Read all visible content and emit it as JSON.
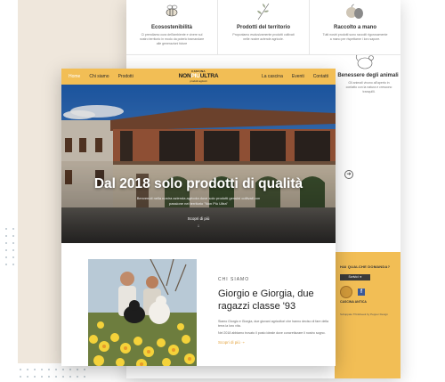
{
  "back_page": {
    "features": [
      {
        "title": "Ecosostenibilità",
        "desc": "Ci prendiamo cura dell'ambiente e vivere sul nostro territorio in modo da poterlo tramandare alle generazioni future",
        "icon": "bee-icon"
      },
      {
        "title": "Prodotti del territorio",
        "desc": "Proponiamo esclusivamente prodotti coltivati nelle nostre aziende agricole.",
        "icon": "herb-icon"
      },
      {
        "title": "Raccolto a mano",
        "desc": "Tutti nostri prodotti sono raccolti rigorosamente a mano per rispettarne i loro sapore.",
        "icon": "produce-icon"
      }
    ],
    "feature2": {
      "title": "Benessere degli animali",
      "desc": "Gli animali vivono all'aperto in contatto con la natura e crescono tranquilli.",
      "icon": "hen-icon"
    },
    "arrow": "➔",
    "cta": {
      "question": "HAI QUALCHE DOMANDA?",
      "button": "Scrivici ➔",
      "badge_text": "CASCINA ANTICA",
      "facebook": "f",
      "credit": "Sviluppato ThinkGeek by Pepper Design"
    }
  },
  "nav": {
    "left": [
      {
        "label": "Home",
        "active": true
      },
      {
        "label": "Chi siamo",
        "active": false
      },
      {
        "label": "Prodotti",
        "active": false
      }
    ],
    "right": [
      {
        "label": "La cascina"
      },
      {
        "label": "Eventi"
      },
      {
        "label": "Contatti"
      }
    ],
    "logo": {
      "line1": "CASCINA",
      "word1": "NON",
      "word2": "PIÙ",
      "word3": "ULTRA",
      "line3": "prodotti agricoli"
    }
  },
  "hero": {
    "title": "Dal 2018 solo prodotti di qualità",
    "subtitle": "Benvenuti nella nostra azienda agricola dove solo prodotti genuini coltivati con passione nel territorio \"Non Più Ultra\"",
    "more": "Scopri di più",
    "arrow": "↓"
  },
  "about": {
    "eyebrow": "CHI SIAMO",
    "title": "Giorgio e Giorgia, due ragazzi classe '93",
    "p1": "Siamo Giorgio e Giorgia, due giovani agricoltori che hanno deciso di fare della terra la loro vita.",
    "p2": "Nel 2018 abbiamo trovato il posto ideale dove concretizzare il nostro sogno.",
    "link": "Scopri di più ➝"
  },
  "colors": {
    "accent": "#f2be55",
    "link": "#e3a23c",
    "beige": "#efe7dc"
  }
}
